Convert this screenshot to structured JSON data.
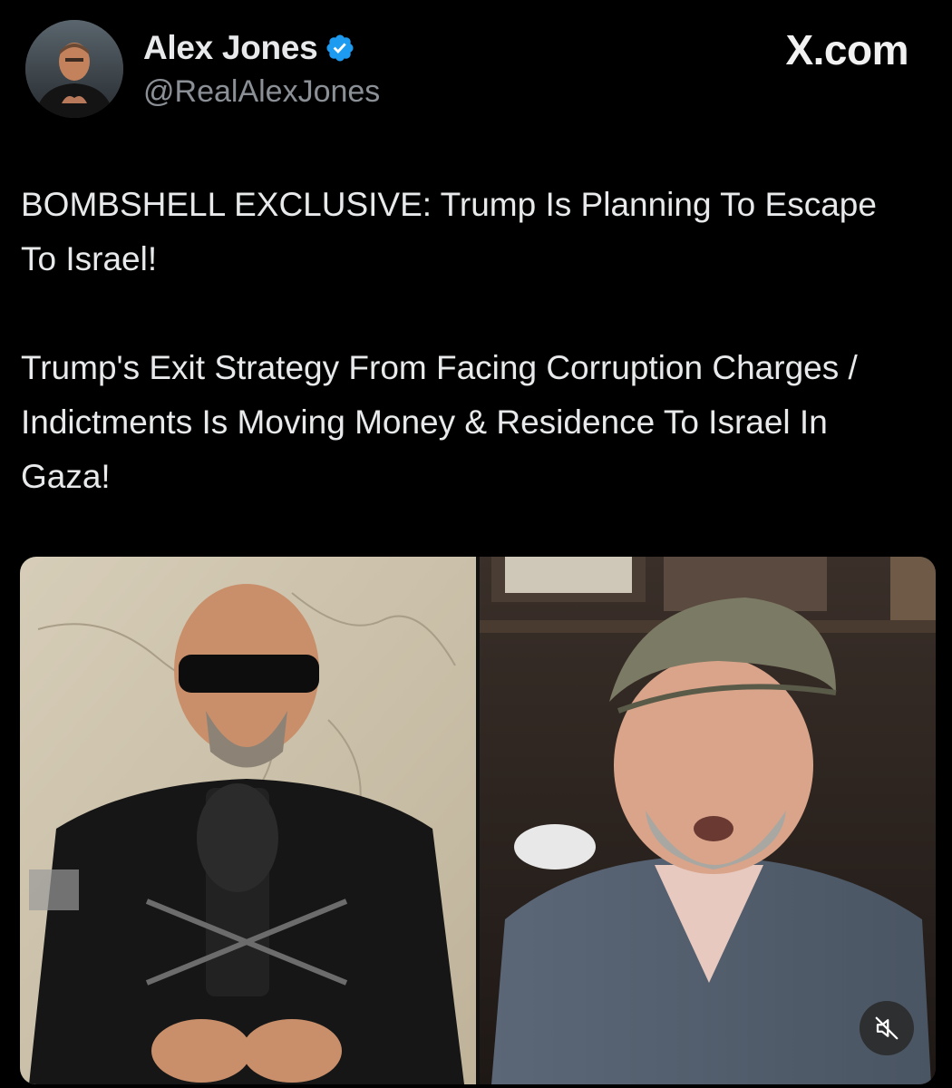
{
  "author": {
    "display_name": "Alex Jones",
    "handle": "@RealAlexJones",
    "verified": true,
    "avatar_icon": "profile-avatar"
  },
  "brand": {
    "label": "X.com"
  },
  "post": {
    "paragraphs": [
      "BOMBSHELL EXCLUSIVE: Trump Is Planning To Escape To Israel!",
      "Trump's Exit Strategy From Facing Corruption Charges / Indictments Is Moving Money & Residence To Israel In Gaza!"
    ]
  },
  "media": {
    "type": "video",
    "layout": "split-screen",
    "muted": true,
    "mute_icon": "speaker-muted-icon"
  },
  "colors": {
    "background": "#000000",
    "text_primary": "#e7e9ea",
    "text_secondary": "#8b9096",
    "verified_badge": "#1d9bf0"
  }
}
